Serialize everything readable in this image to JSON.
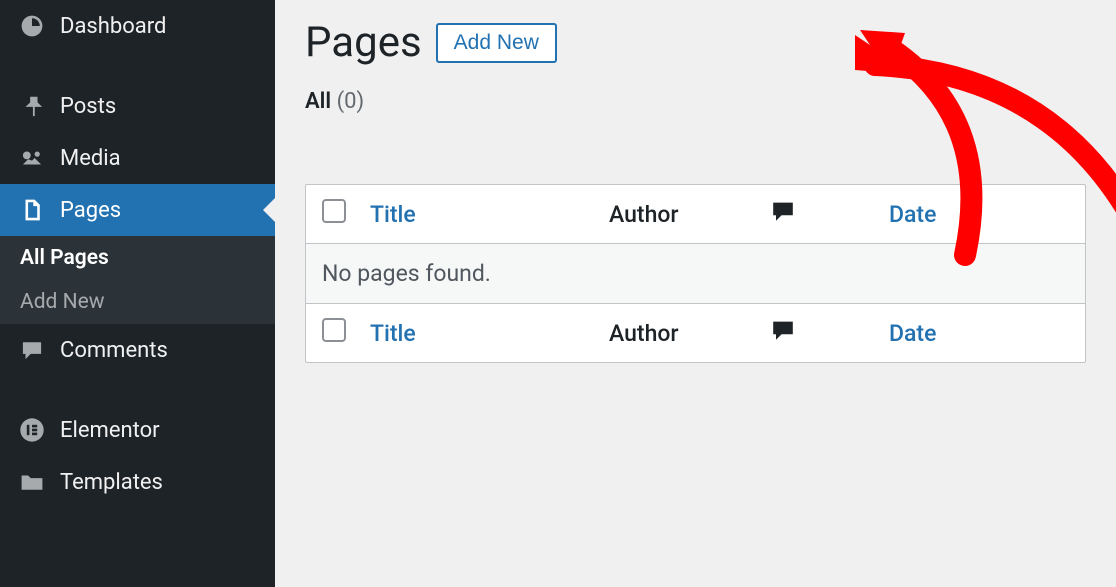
{
  "sidebar": {
    "items": [
      {
        "label": "Dashboard",
        "icon": "dashboard"
      },
      {
        "label": "Posts",
        "icon": "pin"
      },
      {
        "label": "Media",
        "icon": "media"
      },
      {
        "label": "Pages",
        "icon": "pages",
        "active": true
      },
      {
        "label": "Comments",
        "icon": "comment"
      },
      {
        "label": "Elementor",
        "icon": "elementor"
      },
      {
        "label": "Templates",
        "icon": "folder"
      }
    ],
    "submenu": [
      {
        "label": "All Pages",
        "current": true
      },
      {
        "label": "Add New"
      }
    ]
  },
  "page": {
    "title": "Pages",
    "add_new": "Add New"
  },
  "filter": {
    "all_label": "All",
    "all_count": "(0)"
  },
  "table": {
    "columns": {
      "title": "Title",
      "author": "Author",
      "date": "Date"
    },
    "empty_message": "No pages found."
  },
  "annotation": {
    "arrow_color": "#ff0000"
  }
}
